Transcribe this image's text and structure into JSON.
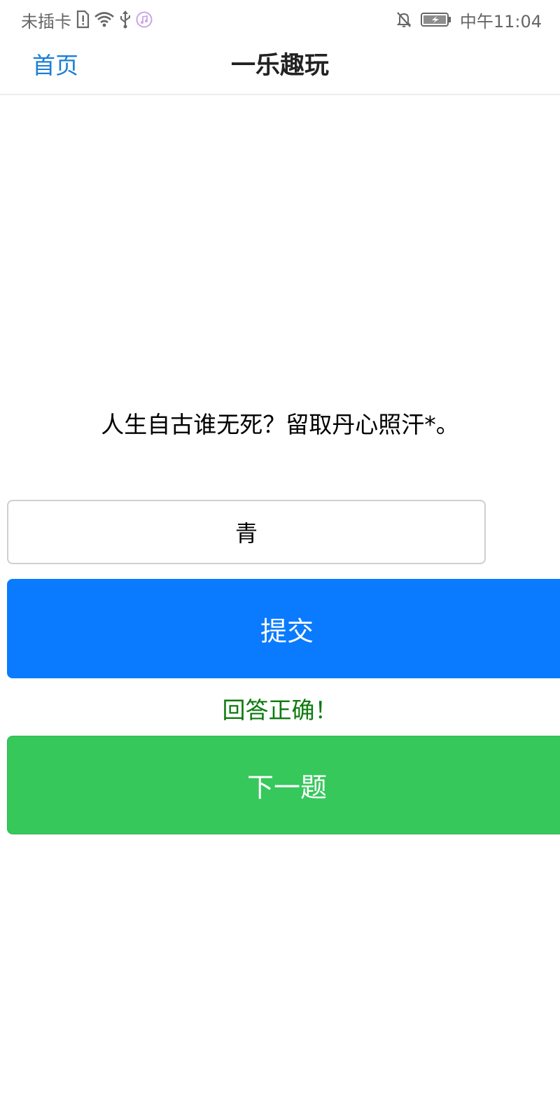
{
  "status_bar": {
    "carrier": "未插卡",
    "time_text": "中午11:04",
    "icons": [
      "sim-alert-icon",
      "wifi-icon",
      "usb-icon",
      "music-icon",
      "bell-off-icon",
      "battery-icon"
    ]
  },
  "header": {
    "home_label": "首页",
    "title": "一乐趣玩"
  },
  "quiz": {
    "question": "人生自古谁无死？留取丹心照汗*。",
    "answer_value": "青",
    "submit_label": "提交",
    "feedback": "回答正确！",
    "next_label": "下一题"
  },
  "colors": {
    "link": "#1a7fd6",
    "submit": "#0a7bff",
    "next": "#36c85b",
    "correct": "#0d7a0d"
  }
}
